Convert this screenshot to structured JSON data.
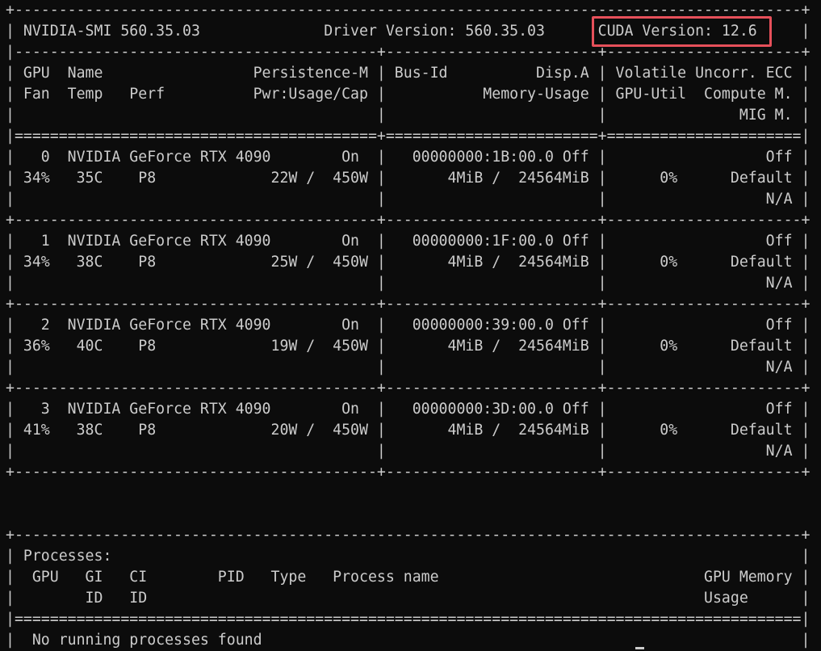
{
  "terminal": {
    "lines": [
      "+-----------------------------------------------------------------------------------------+",
      "| NVIDIA-SMI 560.35.03              Driver Version: 560.35.03      CUDA Version: 12.6     |",
      "|-----------------------------------------+------------------------+----------------------+",
      "| GPU  Name                 Persistence-M | Bus-Id          Disp.A | Volatile Uncorr. ECC |",
      "| Fan  Temp   Perf          Pwr:Usage/Cap |           Memory-Usage | GPU-Util  Compute M. |",
      "|                                         |                        |               MIG M. |",
      "|=========================================+========================+======================|",
      "|   0  NVIDIA GeForce RTX 4090        On  |   00000000:1B:00.0 Off |                  Off |",
      "| 34%   35C    P8             22W /  450W |       4MiB /  24564MiB |      0%      Default |",
      "|                                         |                        |                  N/A |",
      "+-----------------------------------------+------------------------+----------------------+",
      "|   1  NVIDIA GeForce RTX 4090        On  |   00000000:1F:00.0 Off |                  Off |",
      "| 34%   38C    P8             25W /  450W |       4MiB /  24564MiB |      0%      Default |",
      "|                                         |                        |                  N/A |",
      "+-----------------------------------------+------------------------+----------------------+",
      "|   2  NVIDIA GeForce RTX 4090        On  |   00000000:39:00.0 Off |                  Off |",
      "| 36%   40C    P8             19W /  450W |       4MiB /  24564MiB |      0%      Default |",
      "|                                         |                        |                  N/A |",
      "+-----------------------------------------+------------------------+----------------------+",
      "|   3  NVIDIA GeForce RTX 4090        On  |   00000000:3D:00.0 Off |                  Off |",
      "| 41%   38C    P8             20W /  450W |       4MiB /  24564MiB |      0%      Default |",
      "|                                         |                        |                  N/A |",
      "+-----------------------------------------+------------------------+----------------------+",
      "",
      "",
      "+-----------------------------------------------------------------------------------------+",
      "| Processes:                                                                              |",
      "|  GPU   GI   CI        PID   Type   Process name                              GPU Memory |",
      "|        ID   ID                                                               Usage      |",
      "|=========================================================================================|",
      "|  No running processes found                                                             |",
      "+-----------------------------------------------------------------------------------------+"
    ]
  },
  "highlight": {
    "label": "CUDA Version: 12.6",
    "color": "#e6505a"
  },
  "colors": {
    "background": "#0c0c0c",
    "text": "#cccccc"
  }
}
